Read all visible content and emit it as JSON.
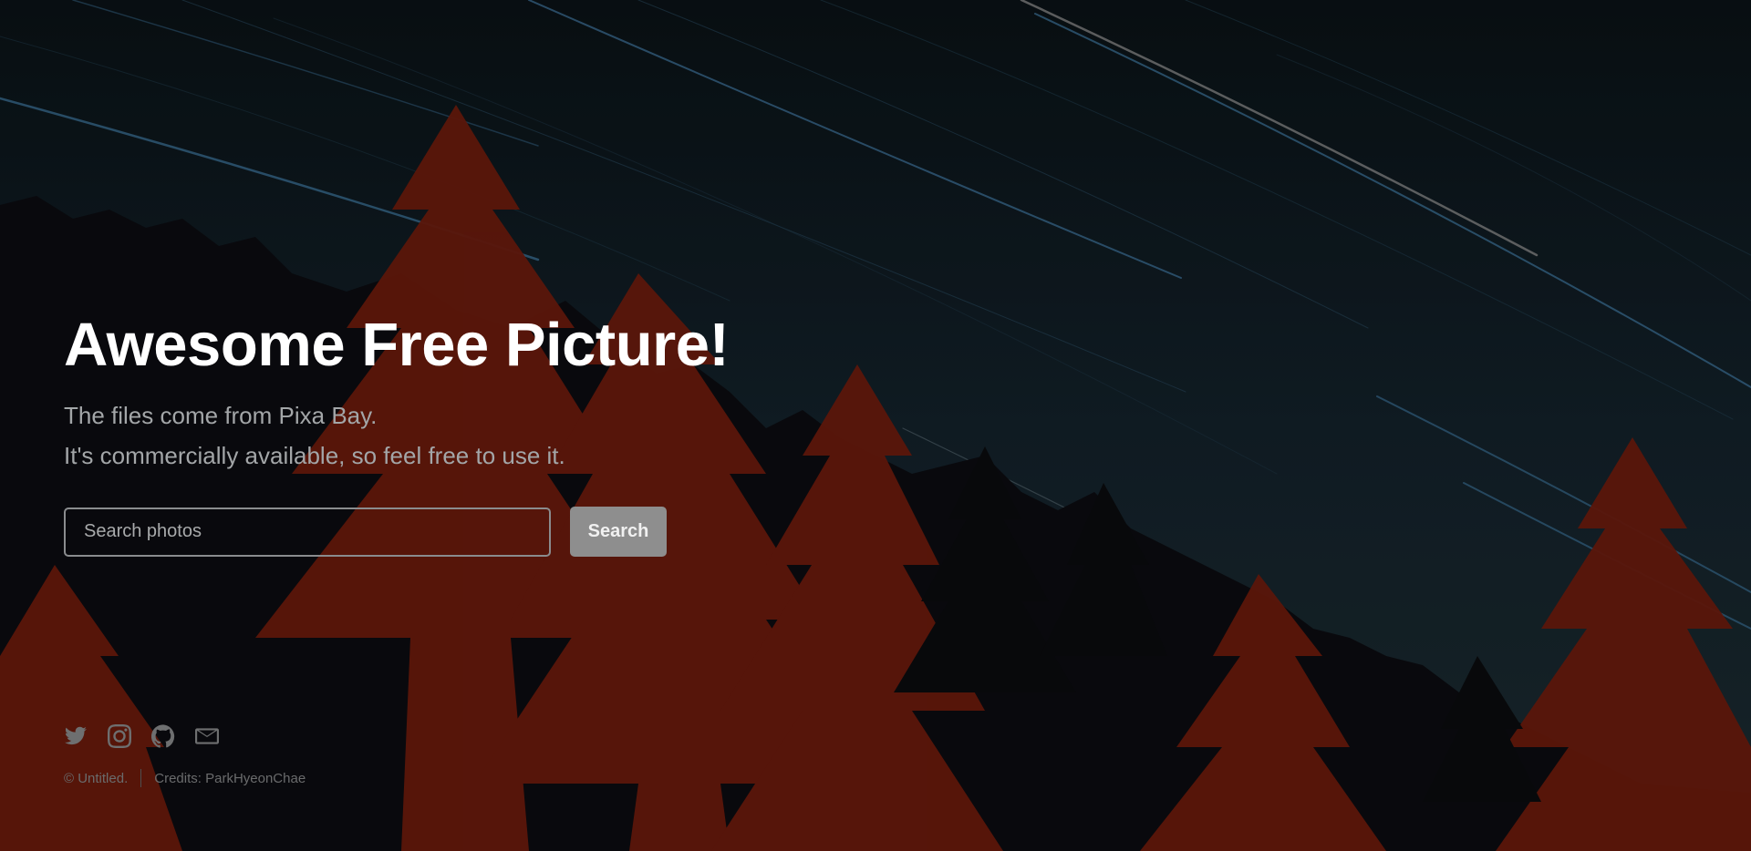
{
  "hero": {
    "title": "Awesome Free Picture!",
    "subtitle_line1": "The files come from Pixa Bay.",
    "subtitle_line2": "It's commercially available, so feel free to use it."
  },
  "search": {
    "placeholder": "Search photos",
    "value": "",
    "button_label": "Search"
  },
  "social": {
    "items": [
      {
        "icon": "twitter-icon"
      },
      {
        "icon": "instagram-icon"
      },
      {
        "icon": "github-icon"
      },
      {
        "icon": "envelope-icon"
      }
    ]
  },
  "footer": {
    "copyright": "© Untitled.",
    "credits": "Credits: ParkHyeonChae"
  },
  "colors": {
    "title": "#ffffff",
    "subtitle": "#a3a6a8",
    "button_bg": "#8e8e8e",
    "tree_red": "#7a1e0e",
    "sky": "#0f1b21"
  }
}
